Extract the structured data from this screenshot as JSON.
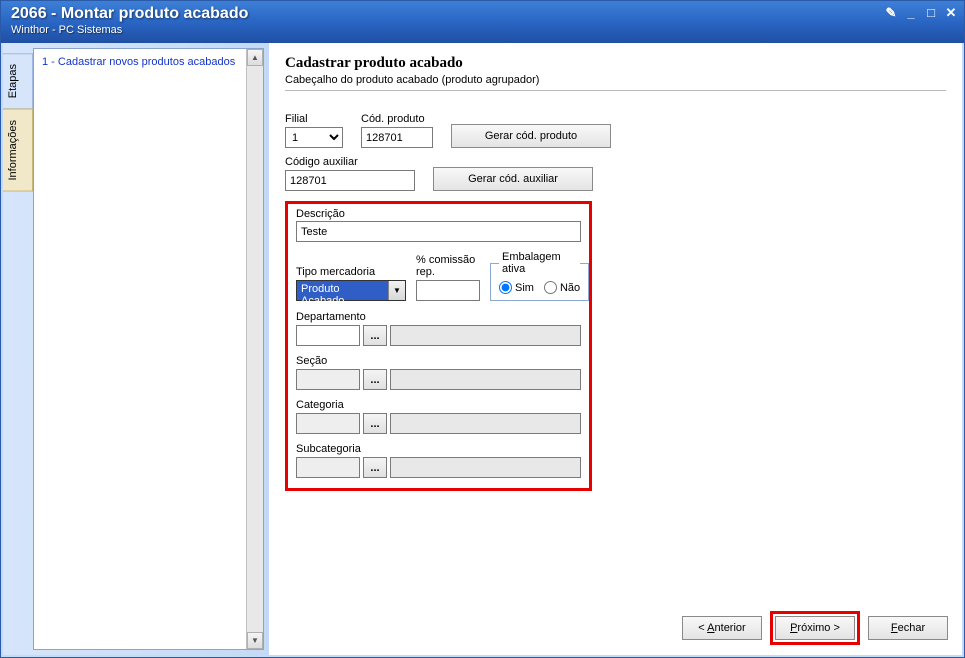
{
  "titlebar": {
    "title": "2066 - Montar produto acabado",
    "subtitle": "Winthor - PC Sistemas"
  },
  "sidebar": {
    "tabs": {
      "etapas": "Etapas",
      "informacoes": "Informações"
    },
    "tree_item": "1 - Cadastrar novos produtos acabados"
  },
  "main": {
    "heading": "Cadastrar produto acabado",
    "subheading": "Cabeçalho do produto acabado (produto agrupador)"
  },
  "form": {
    "filial": {
      "label": "Filial",
      "value": "1"
    },
    "codproduto": {
      "label": "Cód. produto",
      "value": "128701"
    },
    "btn_gerar_cod_produto": "Gerar cód. produto",
    "codauxiliar": {
      "label": "Código auxiliar",
      "value": "128701"
    },
    "btn_gerar_cod_auxiliar": "Gerar cód. auxiliar",
    "descricao": {
      "label": "Descrição",
      "value": "Teste"
    },
    "tipomercadoria": {
      "label": "Tipo mercadoria",
      "value": "Produto Acabado"
    },
    "comissao": {
      "label": "% comissão rep.",
      "value": ""
    },
    "embalagem": {
      "legend": "Embalagem ativa",
      "sim": "Sim",
      "nao": "Não",
      "checked": "sim"
    },
    "departamento": {
      "label": "Departamento"
    },
    "secao": {
      "label": "Seção"
    },
    "categoria": {
      "label": "Categoria"
    },
    "subcategoria": {
      "label": "Subcategoria"
    },
    "ellipsis": "..."
  },
  "footer": {
    "anterior_pre": "< ",
    "anterior_u": "A",
    "anterior_post": "nterior",
    "proximo_u": "P",
    "proximo_post": "róximo >",
    "fechar_u": "F",
    "fechar_post": "echar"
  }
}
